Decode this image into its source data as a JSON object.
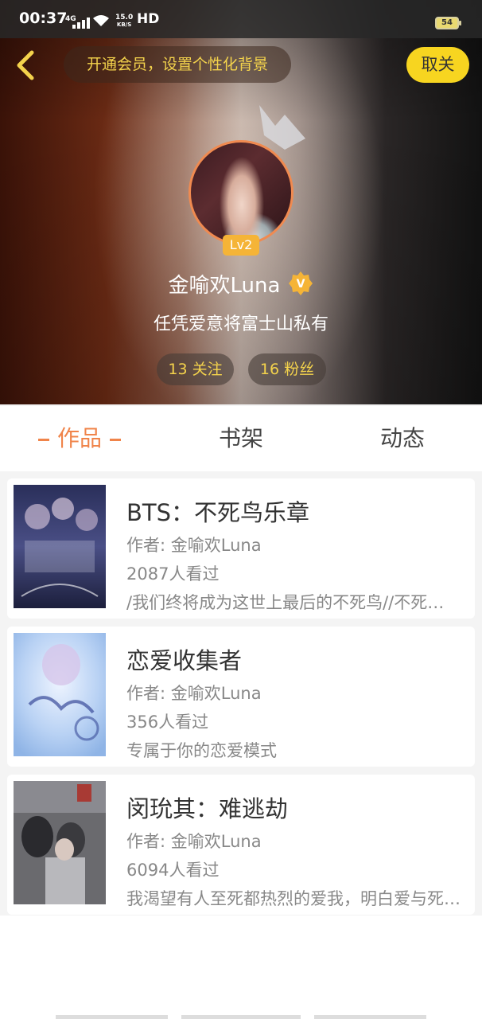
{
  "status_bar": {
    "time": "00:37",
    "network": "4G",
    "speed_value": "15.0",
    "speed_unit": "KB/S",
    "hd": "HD",
    "battery": "54"
  },
  "header": {
    "vip_banner": "开通会员，设置个性化背景",
    "follow_button": "取关"
  },
  "profile": {
    "level": "Lv2",
    "username": "金喻欢Luna",
    "verified_badge": "V",
    "signature": "任凭爱意将富士山私有",
    "following": "13 关注",
    "followers": "16 粉丝"
  },
  "tabs": [
    {
      "label": "作品",
      "active": true
    },
    {
      "label": "书架",
      "active": false
    },
    {
      "label": "动态",
      "active": false
    }
  ],
  "works": [
    {
      "title": "BTS：不死鸟乐章",
      "author": "作者: 金喻欢Luna",
      "views": "2087人看过",
      "description": "/我们终将成为这世上最后的不死鸟//不死鸟乐章"
    },
    {
      "title": "恋爱收集者",
      "author": "作者: 金喻欢Luna",
      "views": "356人看过",
      "description": "专属于你的恋爱模式"
    },
    {
      "title": "闵玧其：难逃劫",
      "author": "作者: 金喻欢Luna",
      "views": "6094人看过",
      "description": "我渴望有人至死都热烈的爱我，明白爱与死亡的重量"
    }
  ],
  "colors": {
    "accent": "#f0844a",
    "gold_text": "#f4d34c",
    "follow_button_bg": "#f7d520",
    "level_badge": "#f5b437"
  },
  "icons": [
    "back-chevron-icon",
    "crown-icon",
    "verified-badge-icon",
    "wifi-icon",
    "signal-icon",
    "battery-icon"
  ]
}
